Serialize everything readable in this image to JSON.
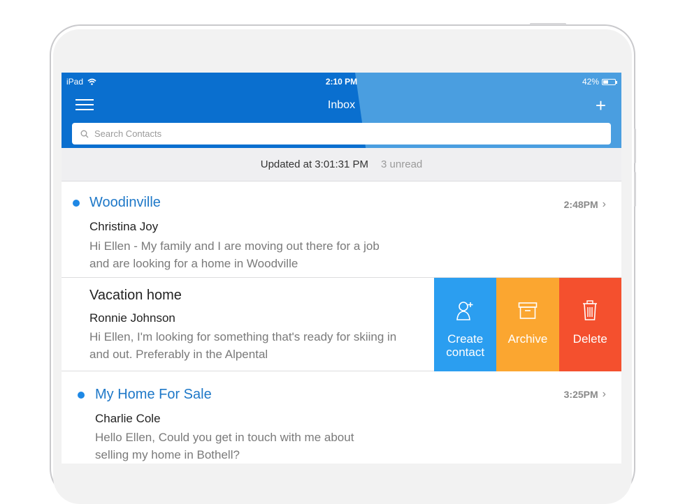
{
  "status_bar": {
    "device": "iPad",
    "time": "2:10 PM",
    "battery": "42%"
  },
  "nav": {
    "title": "Inbox"
  },
  "search": {
    "placeholder": "Search Contacts"
  },
  "updated": {
    "text": "Updated at 3:01:31 PM",
    "unread": "3 unread"
  },
  "messages": [
    {
      "subject": "Woodinville",
      "sender": "Christina Joy",
      "preview": "Hi Ellen - My family and I are moving out there for a job and are looking for a home in Woodville",
      "time": "2:48PM",
      "unread": true
    },
    {
      "subject": "Vacation home",
      "sender": "Ronnie Johnson",
      "preview": "Hi Ellen, I'm looking for something that's ready for skiing in and out.  Preferably in the Alpental",
      "unread": false
    },
    {
      "subject": "My Home For Sale",
      "sender": "Charlie Cole",
      "preview": "Hello Ellen, Could you get in touch with me about selling my home in Bothell?",
      "time": "3:25PM",
      "unread": true
    }
  ],
  "swipe_actions": {
    "create": "Create contact",
    "archive": "Archive",
    "delete": "Delete"
  },
  "colors": {
    "header": "#0a6fcf",
    "create": "#2b9ef0",
    "archive": "#fba630",
    "delete": "#f4502e",
    "unread_dot": "#1e88e5"
  }
}
